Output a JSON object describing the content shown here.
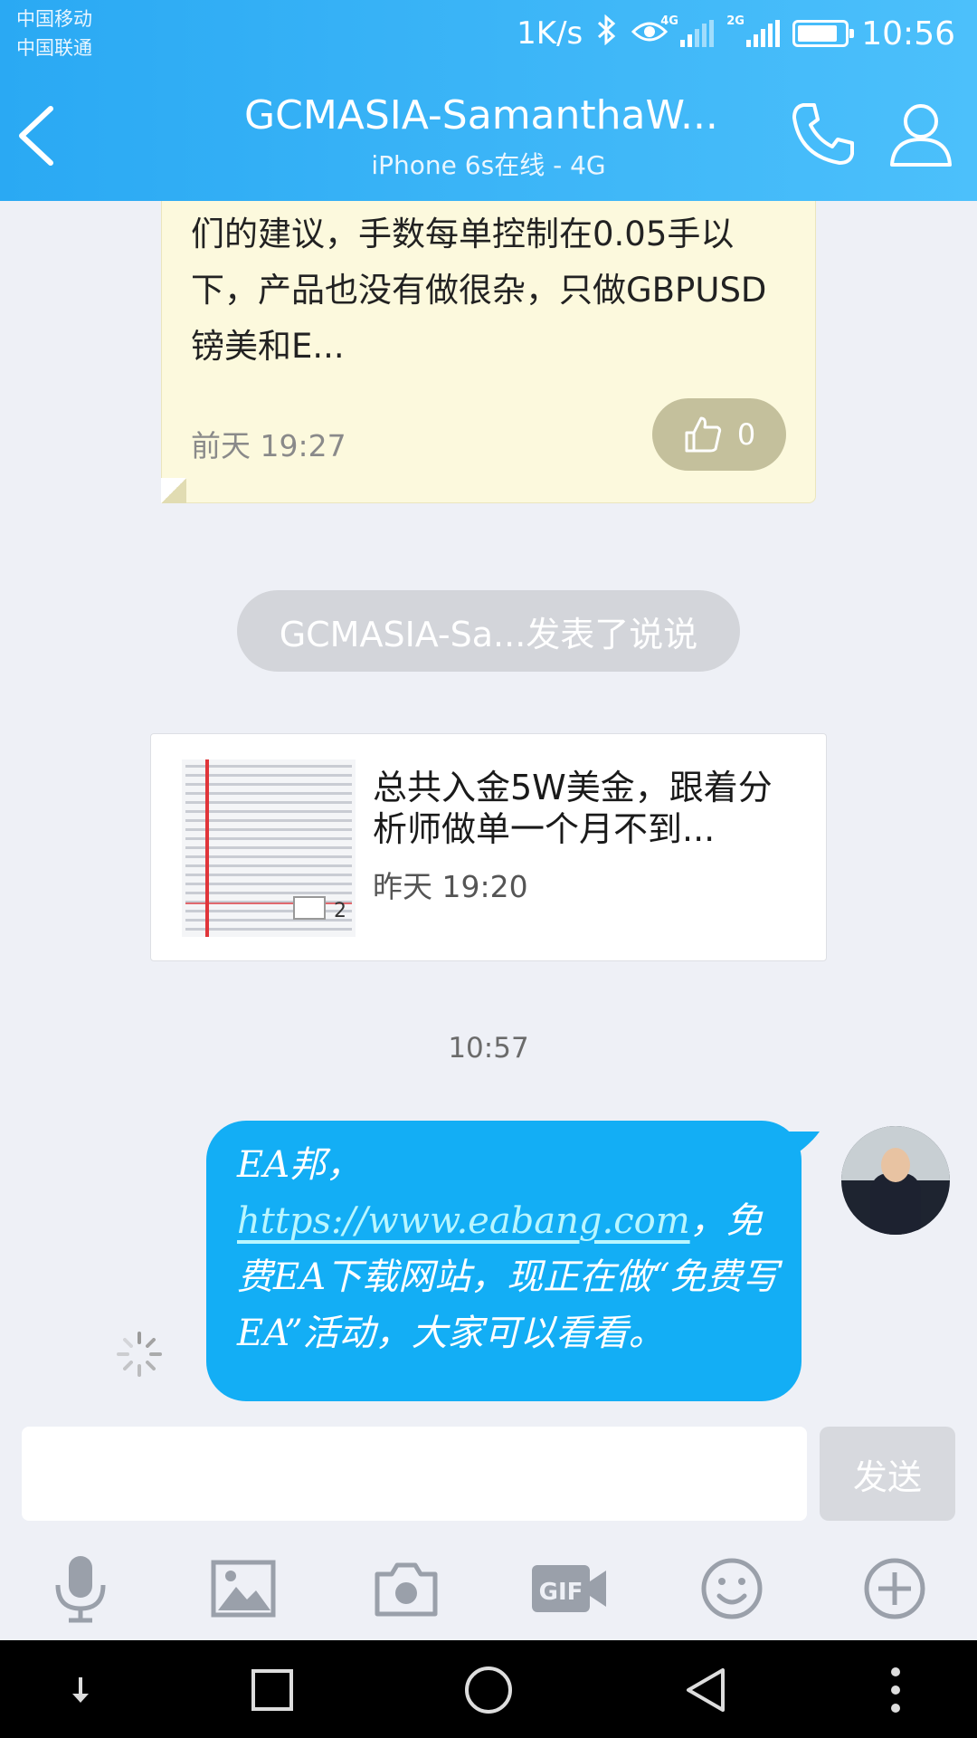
{
  "status_bar": {
    "carrier_1": "中国移动",
    "carrier_2": "中国联通",
    "net_speed": "1K/s",
    "sim1_tag": "4G",
    "sim2_tag": "2G",
    "time": "10:56"
  },
  "header": {
    "title": "GCMASIA-SamanthaW...",
    "subtitle": "iPhone 6s在线 - 4G"
  },
  "messages": {
    "card1": {
      "text": "们的建议，手数每单控制在0.05手以下，产品也没有做很杂，只做GBPUSD镑美和E...",
      "time": "前天 19:27",
      "like_count": "0"
    },
    "notice": "GCMASIA-Sa...发表了说说",
    "post": {
      "text": "总共入金5W美金，跟着分析师做单一个月不到...",
      "time": "昨天 19:20",
      "image_count": "2"
    },
    "time_divider": "10:57",
    "outgoing": {
      "prefix": "EA邦，",
      "link": "https://www.eabang.com",
      "suffix": "，免费EA下载网站，现正在做“免费写EA”活动，大家可以看看。"
    }
  },
  "input": {
    "value": "",
    "send_label": "发送"
  },
  "toolbar": [
    "mic-icon",
    "image-icon",
    "camera-icon",
    "gif-icon",
    "emoji-icon",
    "plus-icon"
  ],
  "colors": {
    "header": "#2aa9f3",
    "bubble": "#13aef5",
    "card": "#fcf9dd",
    "background": "#eef0f6"
  }
}
